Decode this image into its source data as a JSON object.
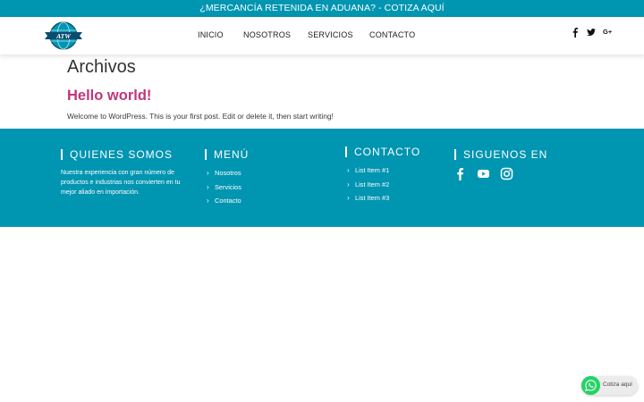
{
  "topbar": {
    "text": "¿MERCANCÍA RETENIDA EN ADUANA? - COTIZA AQUÍ"
  },
  "header": {
    "logo": {
      "text": "ATW",
      "icon": "globe-logo-icon"
    },
    "nav": [
      "INICIO",
      "NOSOTROS",
      "SERVICIOS",
      "CONTACTO"
    ],
    "social": [
      "facebook-icon",
      "twitter-icon",
      "google-plus-icon"
    ],
    "google_plus_label": "G+"
  },
  "main": {
    "page_title": "Archivos",
    "post_title": "Hello world!",
    "post_excerpt": "Welcome to WordPress. This is your first post. Edit or delete it, then start writing!",
    "accent_color": "#c0367a"
  },
  "footer": {
    "bg_color": "#0095b1",
    "about": {
      "heading": "QUIENES SOMOS",
      "text": "Nuestra experiencia con gran número de productos e industrias nos convierten en tu mejor aliado en importación."
    },
    "menu": {
      "heading": "MENÚ",
      "items": [
        "Nosotros",
        "Servicios",
        "Contacto"
      ]
    },
    "contact": {
      "heading": "CONTACTO",
      "items": [
        "List Item #1",
        "List Item #2",
        "List Item #3"
      ]
    },
    "follow": {
      "heading": "SIGUENOS EN",
      "icons": [
        "facebook-icon",
        "youtube-icon",
        "instagram-icon"
      ]
    }
  },
  "whatsapp": {
    "label": "Cotiza aquí",
    "icon": "whatsapp-icon"
  }
}
